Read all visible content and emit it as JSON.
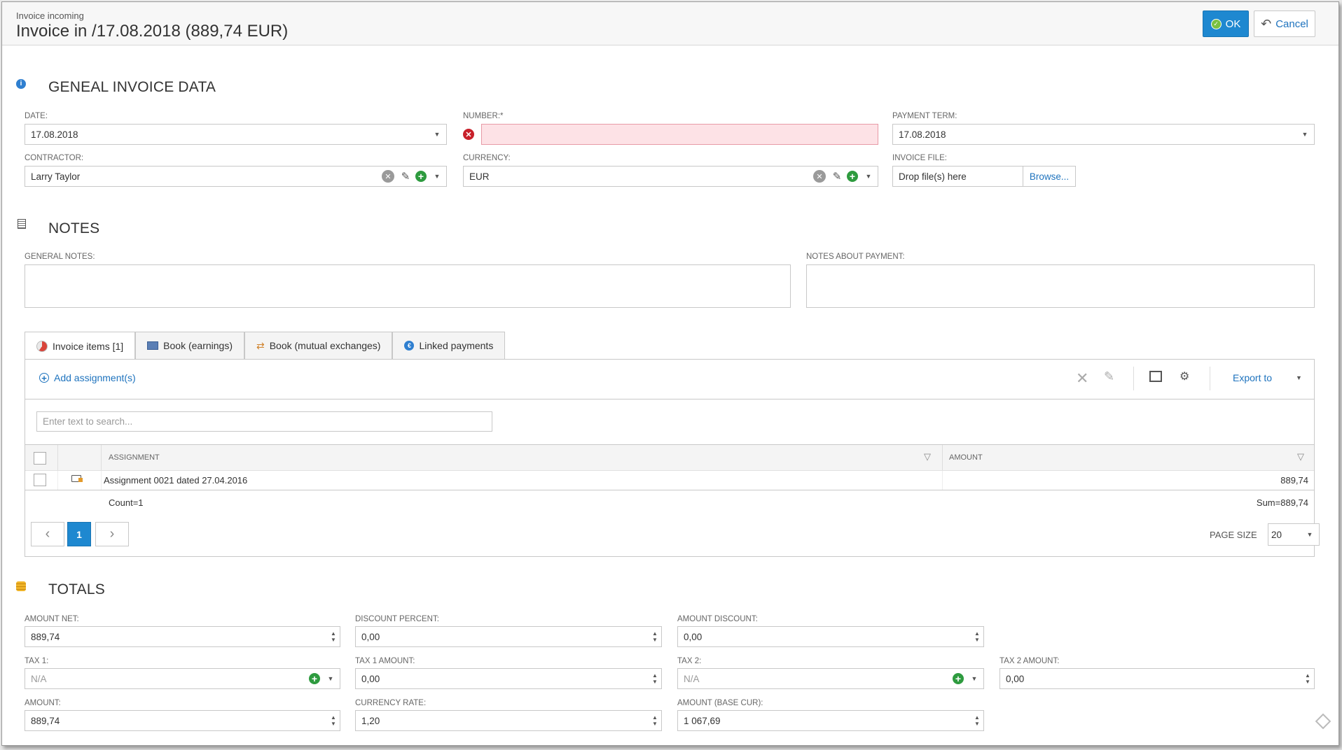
{
  "header": {
    "subtitle": "Invoice incoming",
    "title": "Invoice in /17.08.2018 (889,74 EUR)",
    "ok_label": "OK",
    "cancel_label": "Cancel"
  },
  "general": {
    "title": "GENEAL INVOICE DATA",
    "date_label": "DATE:",
    "date_value": "17.08.2018",
    "number_label": "NUMBER:*",
    "number_value": "",
    "payment_term_label": "PAYMENT TERM:",
    "payment_term_value": "17.08.2018",
    "contractor_label": "CONTRACTOR:",
    "contractor_value": "Larry Taylor",
    "currency_label": "CURRENCY:",
    "currency_value": "EUR",
    "invoice_file_label": "INVOICE FILE:",
    "invoice_file_placeholder": "Drop file(s) here",
    "browse_label": "Browse..."
  },
  "notes": {
    "title": "NOTES",
    "general_label": "GENERAL NOTES:",
    "payment_label": "NOTES ABOUT PAYMENT:"
  },
  "tabs": [
    {
      "label": "Invoice items [1]",
      "active": true
    },
    {
      "label": "Book (earnings)"
    },
    {
      "label": "Book (mutual exchanges)"
    },
    {
      "label": "Linked payments"
    }
  ],
  "grid": {
    "add_label": "Add assignment(s)",
    "export_label": "Export to",
    "search_placeholder": "Enter text to search...",
    "col_assignment": "ASSIGNMENT",
    "col_amount": "AMOUNT",
    "rows": [
      {
        "assignment": "Assignment 0021 dated 27.04.2016",
        "amount": "889,74"
      }
    ],
    "count_text": "Count=1",
    "sum_text": "Sum=889,74",
    "current_page": "1",
    "page_size_label": "PAGE SIZE",
    "page_size_value": "20"
  },
  "totals": {
    "title": "TOTALS",
    "amount_net_label": "AMOUNT NET:",
    "amount_net_value": "889,74",
    "discount_percent_label": "DISCOUNT PERCENT:",
    "discount_percent_value": "0,00",
    "amount_discount_label": "AMOUNT DISCOUNT:",
    "amount_discount_value": "0,00",
    "tax1_label": "TAX 1:",
    "tax1_value": "N/A",
    "tax1_amount_label": "TAX 1 AMOUNT:",
    "tax1_amount_value": "0,00",
    "tax2_label": "TAX 2:",
    "tax2_value": "N/A",
    "tax2_amount_label": "TAX 2 AMOUNT:",
    "tax2_amount_value": "0,00",
    "amount_label": "AMOUNT:",
    "amount_value": "889,74",
    "currency_rate_label": "CURRENCY RATE:",
    "currency_rate_value": "1,20",
    "amount_base_label": "AMOUNT (BASE CUR):",
    "amount_base_value": "1 067,69"
  },
  "colors": {
    "accent": "#1e88d0",
    "link": "#1e73be",
    "error_fill": "#fde2e6",
    "error_border": "#e79aa6",
    "add_green": "#2e9b3f",
    "error_red": "#c8202a"
  }
}
